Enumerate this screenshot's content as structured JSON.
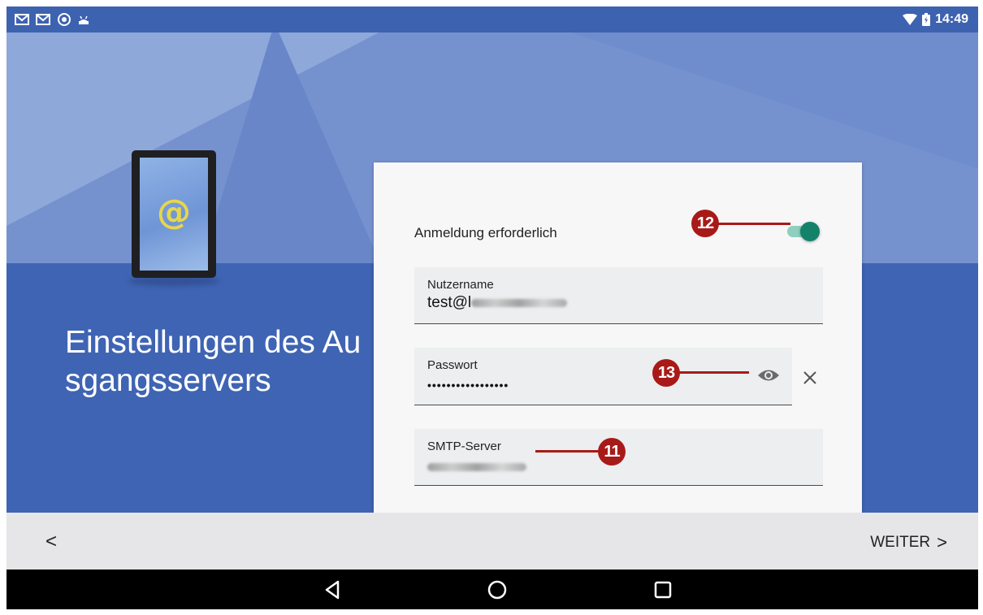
{
  "status_bar": {
    "notifications": [
      "gmail-icon",
      "gmail-icon",
      "sync-icon",
      "android-icon"
    ],
    "wifi": "wifi-icon",
    "battery": "battery-icon",
    "time": "14:49"
  },
  "page": {
    "title": "Einstellungen des Ausgangsservers",
    "illustration": "tablet-at-icon",
    "at_symbol": "@"
  },
  "form": {
    "auth_label": "Anmeldung erforderlich",
    "auth_enabled": true,
    "username": {
      "label": "Nutzername",
      "value_prefix": "test@l"
    },
    "password": {
      "label": "Passwort",
      "value": "•••••••••••••••••"
    },
    "smtp": {
      "label": "SMTP-Server"
    }
  },
  "callouts": {
    "c11": "11",
    "c12": "12",
    "c13": "13"
  },
  "nav": {
    "back": "<",
    "next_label": "WEITER",
    "next_chevron": ">"
  },
  "colors": {
    "accent": "#14826a",
    "callout": "#a81a18",
    "header_blue": "#3f64b3"
  }
}
